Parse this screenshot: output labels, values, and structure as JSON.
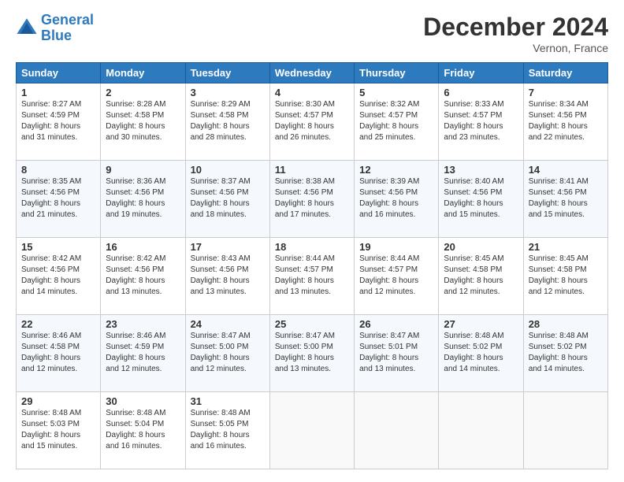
{
  "logo": {
    "line1": "General",
    "line2": "Blue"
  },
  "title": "December 2024",
  "location": "Vernon, France",
  "days_header": [
    "Sunday",
    "Monday",
    "Tuesday",
    "Wednesday",
    "Thursday",
    "Friday",
    "Saturday"
  ],
  "weeks": [
    [
      {
        "day": "1",
        "sunrise": "8:27 AM",
        "sunset": "4:59 PM",
        "daylight": "8 hours and 31 minutes."
      },
      {
        "day": "2",
        "sunrise": "8:28 AM",
        "sunset": "4:58 PM",
        "daylight": "8 hours and 30 minutes."
      },
      {
        "day": "3",
        "sunrise": "8:29 AM",
        "sunset": "4:58 PM",
        "daylight": "8 hours and 28 minutes."
      },
      {
        "day": "4",
        "sunrise": "8:30 AM",
        "sunset": "4:57 PM",
        "daylight": "8 hours and 26 minutes."
      },
      {
        "day": "5",
        "sunrise": "8:32 AM",
        "sunset": "4:57 PM",
        "daylight": "8 hours and 25 minutes."
      },
      {
        "day": "6",
        "sunrise": "8:33 AM",
        "sunset": "4:57 PM",
        "daylight": "8 hours and 23 minutes."
      },
      {
        "day": "7",
        "sunrise": "8:34 AM",
        "sunset": "4:56 PM",
        "daylight": "8 hours and 22 minutes."
      }
    ],
    [
      {
        "day": "8",
        "sunrise": "8:35 AM",
        "sunset": "4:56 PM",
        "daylight": "8 hours and 21 minutes."
      },
      {
        "day": "9",
        "sunrise": "8:36 AM",
        "sunset": "4:56 PM",
        "daylight": "8 hours and 19 minutes."
      },
      {
        "day": "10",
        "sunrise": "8:37 AM",
        "sunset": "4:56 PM",
        "daylight": "8 hours and 18 minutes."
      },
      {
        "day": "11",
        "sunrise": "8:38 AM",
        "sunset": "4:56 PM",
        "daylight": "8 hours and 17 minutes."
      },
      {
        "day": "12",
        "sunrise": "8:39 AM",
        "sunset": "4:56 PM",
        "daylight": "8 hours and 16 minutes."
      },
      {
        "day": "13",
        "sunrise": "8:40 AM",
        "sunset": "4:56 PM",
        "daylight": "8 hours and 15 minutes."
      },
      {
        "day": "14",
        "sunrise": "8:41 AM",
        "sunset": "4:56 PM",
        "daylight": "8 hours and 15 minutes."
      }
    ],
    [
      {
        "day": "15",
        "sunrise": "8:42 AM",
        "sunset": "4:56 PM",
        "daylight": "8 hours and 14 minutes."
      },
      {
        "day": "16",
        "sunrise": "8:42 AM",
        "sunset": "4:56 PM",
        "daylight": "8 hours and 13 minutes."
      },
      {
        "day": "17",
        "sunrise": "8:43 AM",
        "sunset": "4:56 PM",
        "daylight": "8 hours and 13 minutes."
      },
      {
        "day": "18",
        "sunrise": "8:44 AM",
        "sunset": "4:57 PM",
        "daylight": "8 hours and 13 minutes."
      },
      {
        "day": "19",
        "sunrise": "8:44 AM",
        "sunset": "4:57 PM",
        "daylight": "8 hours and 12 minutes."
      },
      {
        "day": "20",
        "sunrise": "8:45 AM",
        "sunset": "4:58 PM",
        "daylight": "8 hours and 12 minutes."
      },
      {
        "day": "21",
        "sunrise": "8:45 AM",
        "sunset": "4:58 PM",
        "daylight": "8 hours and 12 minutes."
      }
    ],
    [
      {
        "day": "22",
        "sunrise": "8:46 AM",
        "sunset": "4:58 PM",
        "daylight": "8 hours and 12 minutes."
      },
      {
        "day": "23",
        "sunrise": "8:46 AM",
        "sunset": "4:59 PM",
        "daylight": "8 hours and 12 minutes."
      },
      {
        "day": "24",
        "sunrise": "8:47 AM",
        "sunset": "5:00 PM",
        "daylight": "8 hours and 12 minutes."
      },
      {
        "day": "25",
        "sunrise": "8:47 AM",
        "sunset": "5:00 PM",
        "daylight": "8 hours and 13 minutes."
      },
      {
        "day": "26",
        "sunrise": "8:47 AM",
        "sunset": "5:01 PM",
        "daylight": "8 hours and 13 minutes."
      },
      {
        "day": "27",
        "sunrise": "8:48 AM",
        "sunset": "5:02 PM",
        "daylight": "8 hours and 14 minutes."
      },
      {
        "day": "28",
        "sunrise": "8:48 AM",
        "sunset": "5:02 PM",
        "daylight": "8 hours and 14 minutes."
      }
    ],
    [
      {
        "day": "29",
        "sunrise": "8:48 AM",
        "sunset": "5:03 PM",
        "daylight": "8 hours and 15 minutes."
      },
      {
        "day": "30",
        "sunrise": "8:48 AM",
        "sunset": "5:04 PM",
        "daylight": "8 hours and 16 minutes."
      },
      {
        "day": "31",
        "sunrise": "8:48 AM",
        "sunset": "5:05 PM",
        "daylight": "8 hours and 16 minutes."
      },
      null,
      null,
      null,
      null
    ]
  ],
  "labels": {
    "sunrise": "Sunrise: ",
    "sunset": "Sunset: ",
    "daylight": "Daylight: "
  }
}
